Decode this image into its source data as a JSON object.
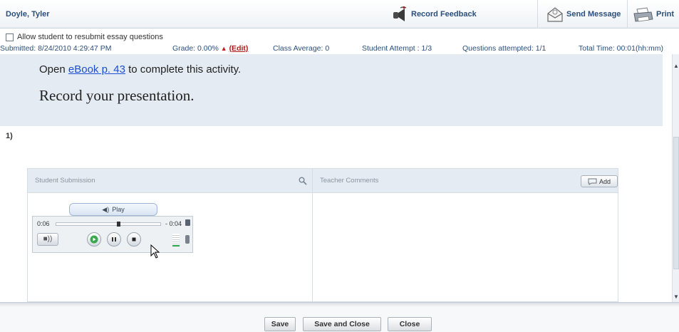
{
  "header": {
    "student_name": "Doyle, Tyler",
    "record_feedback_label": "Record Feedback",
    "send_message_label": "Send Message",
    "print_label": "Print"
  },
  "info": {
    "resubmit_label": "Allow student to resubmit essay questions",
    "submitted": "Submitted: 8/24/2010 4:29:47 PM",
    "grade_label": "Grade: 0.00%",
    "edit_label": "(Edit)",
    "class_average": "Class Average: 0",
    "student_attempt": "Student Attempt : 1/3",
    "questions_attempted": "Questions attempted: 1/1",
    "total_time": "Total Time: 00:01(hh:mm)"
  },
  "prompt": {
    "open_prefix": "Open ",
    "ebook_link": "eBook p. 43",
    "open_suffix": " to complete this activity.",
    "record_text": "Record your presentation."
  },
  "question": {
    "number": "1)"
  },
  "submission": {
    "student_title": "Student Submission",
    "teacher_title": "Teacher Comments",
    "add_label": "Add",
    "play_label": "Play",
    "time_elapsed": "0:06",
    "time_remaining": "- 0:04",
    "progress_fraction": 0.6
  },
  "footer": {
    "save_label": "Save",
    "save_close_label": "Save and Close",
    "close_label": "Close"
  },
  "colors": {
    "header_text": "#2b4f7a",
    "link": "#1a4fd0",
    "edit": "#b01a1a",
    "panel_bg": "#e4ebf2"
  }
}
